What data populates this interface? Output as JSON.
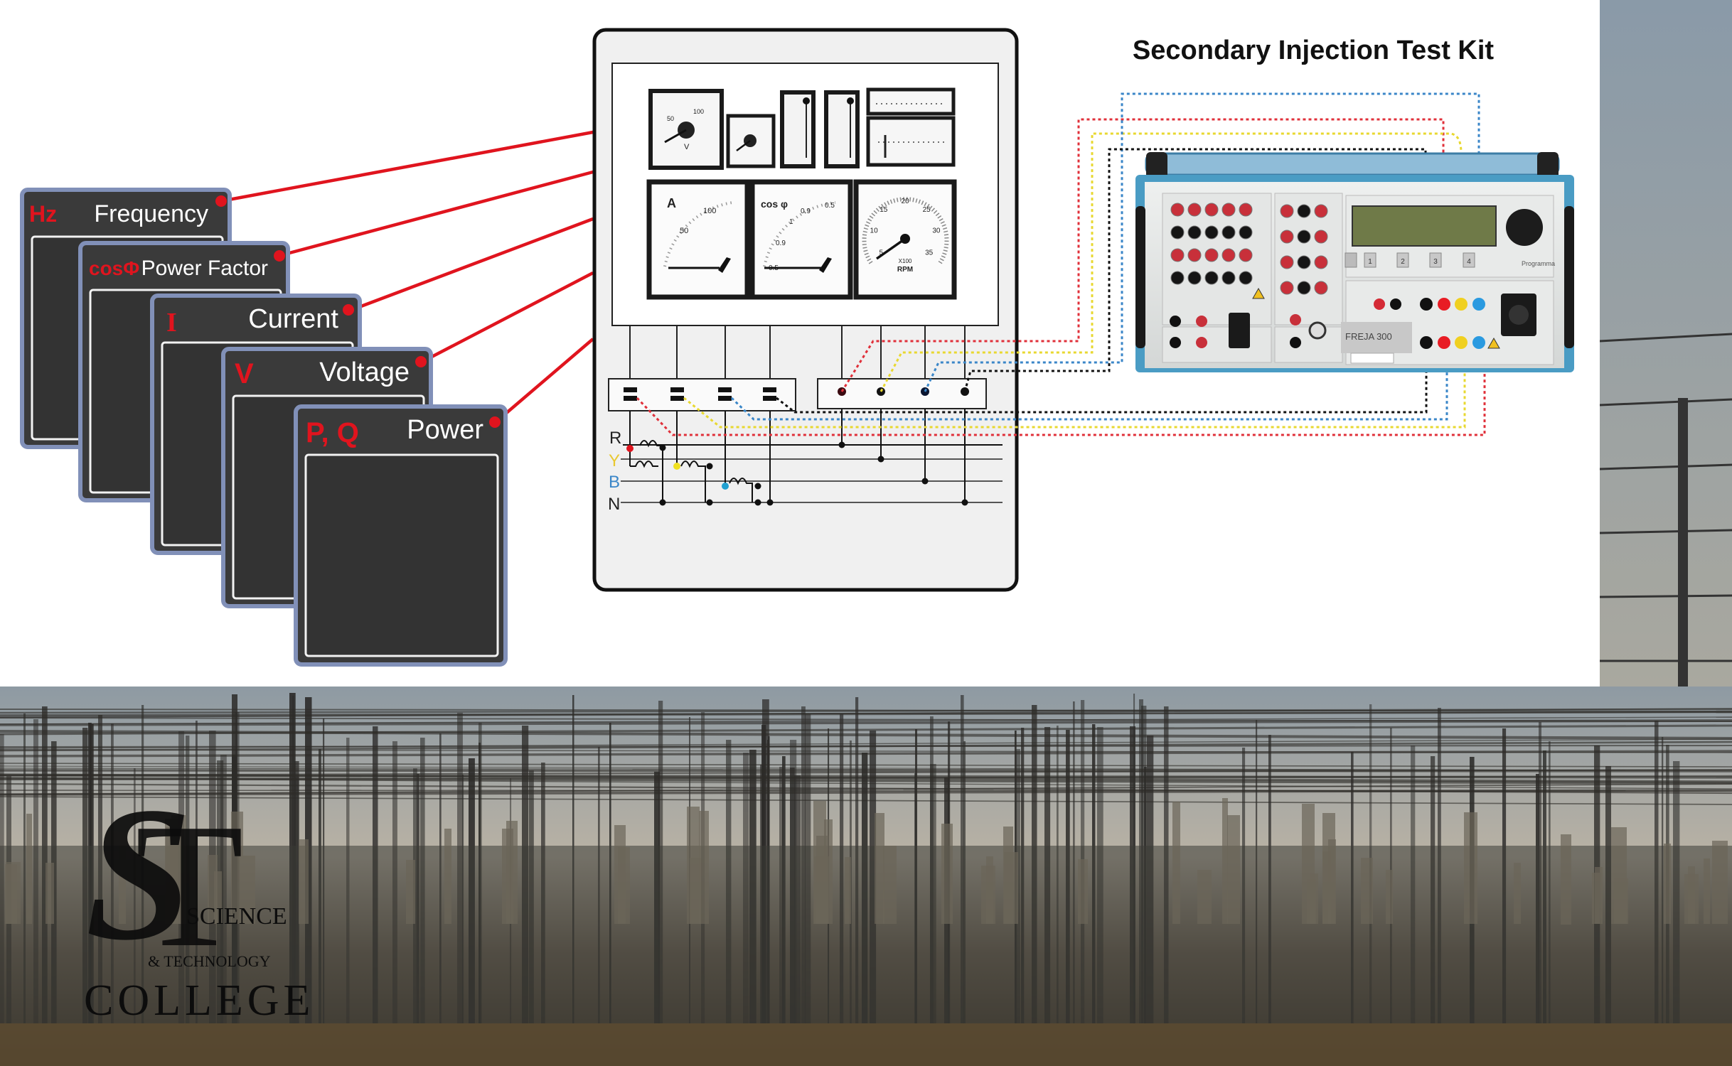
{
  "title": "Secondary Injection Test Kit",
  "panels": [
    {
      "symbol": "Hz",
      "label": "Frequency"
    },
    {
      "symbol": "cosΦ",
      "label": "Power Factor"
    },
    {
      "symbol": "I",
      "label": "Current"
    },
    {
      "symbol": "V",
      "label": "Voltage"
    },
    {
      "symbol": "P, Q",
      "label": "Power"
    }
  ],
  "phases": [
    "R",
    "Y",
    "B",
    "N"
  ],
  "meters": {
    "ammeter": {
      "unit": "A",
      "ticks": [
        "50",
        "100"
      ]
    },
    "pf_meter": {
      "unit": "cos φ",
      "ticks": [
        "0.9",
        "1",
        "0.9",
        "0.5",
        "0.5"
      ]
    },
    "tachometer": {
      "unit": "RPM",
      "multiplier": "X100",
      "ticks": [
        "5",
        "10",
        "15",
        "20",
        "25",
        "30",
        "35"
      ]
    },
    "voltmeter": {
      "unit": "V",
      "ticks": [
        "50",
        "100"
      ]
    }
  },
  "test_kit": {
    "model": "FREJA 300",
    "buttons": [
      "1",
      "2",
      "3",
      "4"
    ],
    "brand": "Programma"
  },
  "logo": {
    "initials": "ST",
    "line1": "SCIENCE",
    "line2": "& TECHNOLOGY",
    "line3": "COLLEGE"
  },
  "colors": {
    "panel_fill": "#3a3a3a",
    "panel_border": "#8190b8",
    "accent_red": "#e0141e",
    "wire_red": "#e0303a",
    "wire_yellow": "#e8d830",
    "wire_blue": "#3a86c8",
    "wire_black": "#111111",
    "kit_frame": "#4a9cc4"
  }
}
